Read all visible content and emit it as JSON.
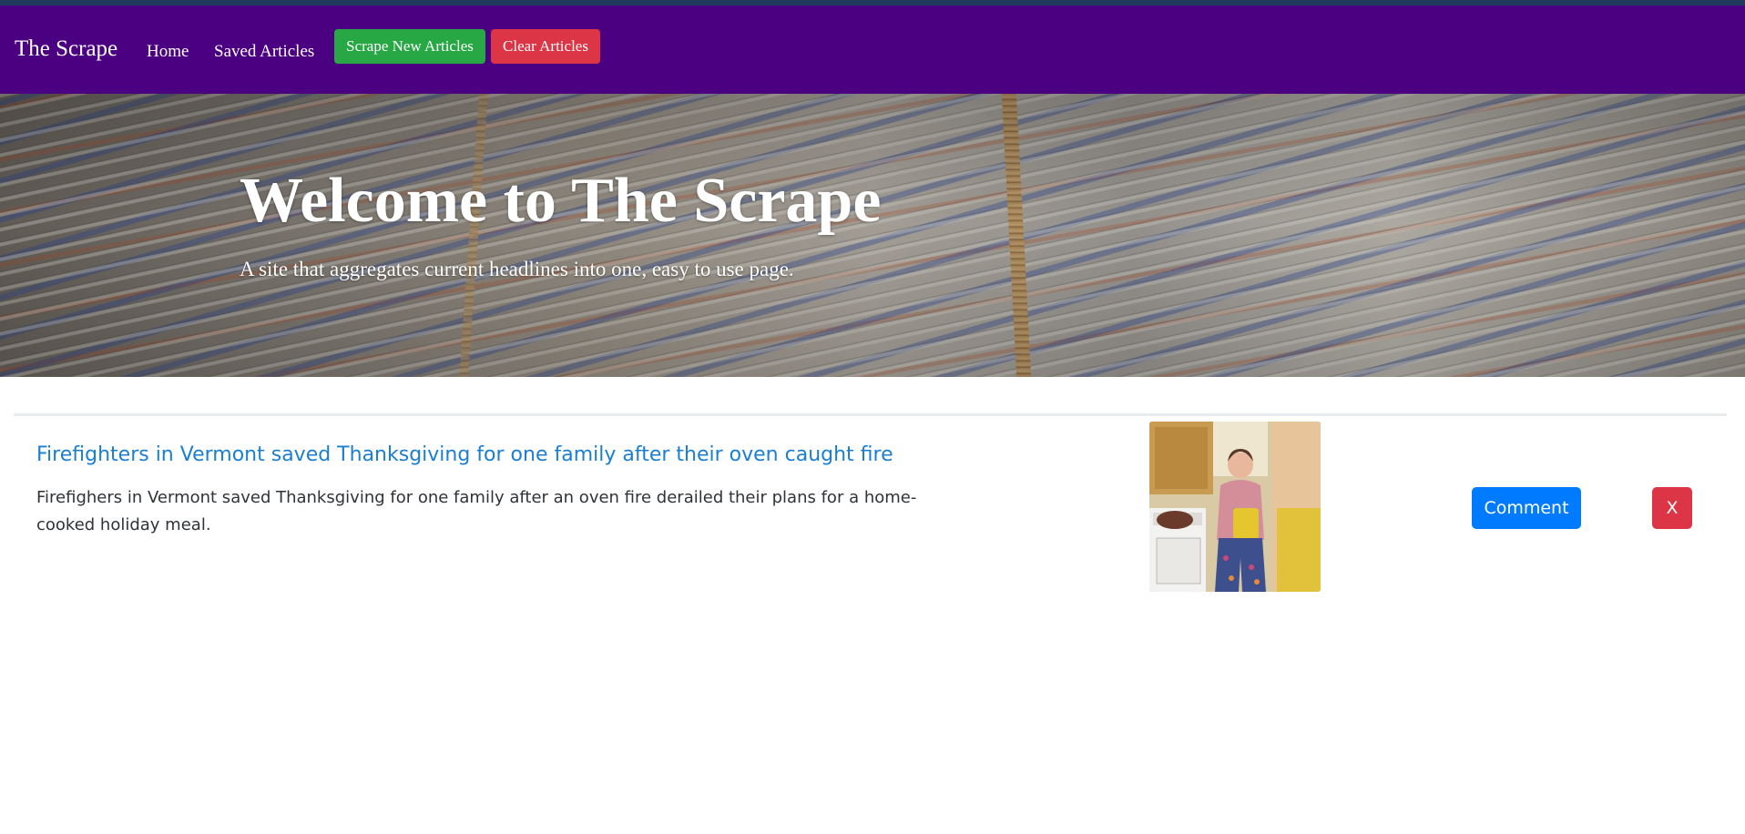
{
  "navbar": {
    "brand": "The Scrape",
    "links": {
      "home": "Home",
      "saved": "Saved Articles"
    },
    "buttons": {
      "scrape": "Scrape New Articles",
      "clear": "Clear Articles"
    },
    "color": "#4b0082"
  },
  "hero": {
    "title": "Welcome to The Scrape",
    "subtitle": "A site that aggregates current headlines into one, easy to use page."
  },
  "articles": [
    {
      "headline": "Firefighters in Vermont saved Thanksgiving for one family after their oven caught fire",
      "summary": "Firefighers in Vermont saved Thanksgiving for one family after an oven fire derailed their plans for a home-cooked holiday meal.",
      "comment_label": "Comment",
      "delete_label": "X"
    }
  ],
  "colors": {
    "success": "#28a745",
    "danger": "#dc3545",
    "primary": "#007bff",
    "link": "#1a7fd3"
  }
}
